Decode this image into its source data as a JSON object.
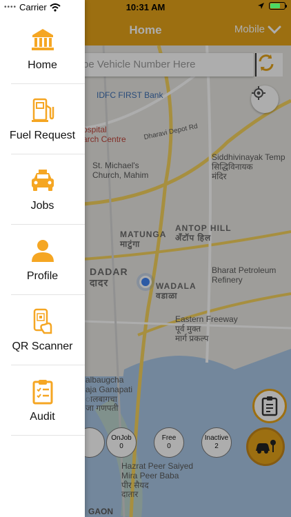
{
  "status_bar": {
    "carrier": "Carrier",
    "time": "10:31 AM"
  },
  "header": {
    "title": "Home",
    "mode": "Mobile"
  },
  "search": {
    "placeholder": "be Vehicle Number Here"
  },
  "map": {
    "labels": {
      "idfc": "IDFC FIRST Bank",
      "hospital": "ospital\narch Centre",
      "stmichael": "St. Michael's\nChurch, Mahim",
      "siddhi": "Siddhivinayak Temp\nसिद्धिविनायक\nमंदिर",
      "matunga": "MATUNGA\nमाटुंगा",
      "antop": "ANTOP HILL\nॲंटॉप हिल",
      "dadar": "DADAR\nदादर",
      "wadala": "WADALA\nवडाळा",
      "bpcl": "Bharat Petroleum\nRefinery",
      "freeway": "Eastern Freeway\nपूर्व मुक्त\nमार्ग प्रकल्प",
      "lalbaug": "albaugcha\naja Ganapati\nालबागचा\nजा गणपती",
      "hazrat": "Hazrat Peer Saiyed\nMira Peer Baba\nपीर सैयद\nदातार",
      "road": "Dharavi Depot Rd",
      "bottom": "GAON"
    }
  },
  "status_chips": [
    {
      "label": "OnJob",
      "count": "0"
    },
    {
      "label": "Free",
      "count": "0"
    },
    {
      "label": "Inactive",
      "count": "2"
    }
  ],
  "drawer": {
    "items": [
      {
        "label": "Home",
        "icon": "bank-icon"
      },
      {
        "label": "Fuel Request",
        "icon": "fuel-pump-icon"
      },
      {
        "label": "Jobs",
        "icon": "taxi-icon"
      },
      {
        "label": "Profile",
        "icon": "person-icon"
      },
      {
        "label": "QR Scanner",
        "icon": "qr-phone-icon"
      },
      {
        "label": "Audit",
        "icon": "clipboard-icon"
      }
    ]
  },
  "colors": {
    "accent": "#e6a41a",
    "user_dot": "#4285f4"
  }
}
